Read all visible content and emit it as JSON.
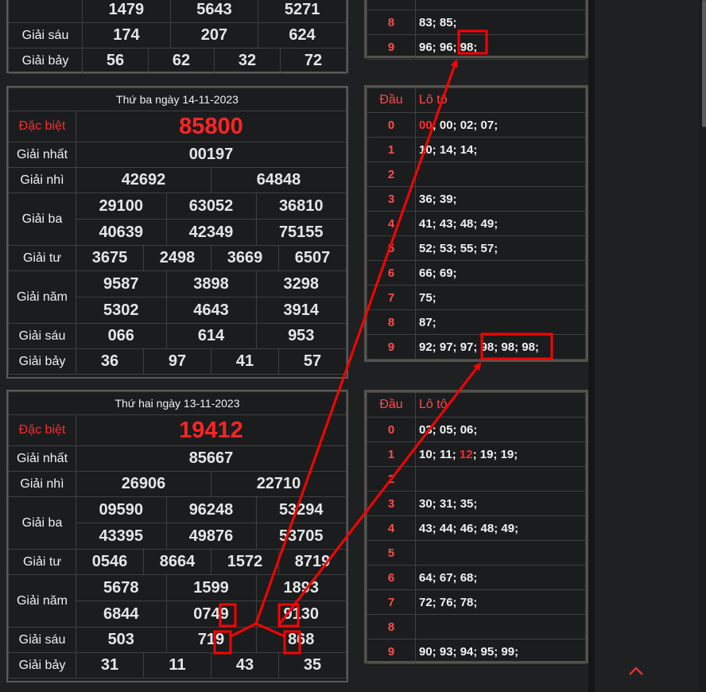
{
  "top_block": {
    "rows": [
      {
        "label": "",
        "values": [
          "1479",
          "5643",
          "5271"
        ]
      },
      {
        "label": "Giải sáu",
        "values": [
          "174",
          "207",
          "624"
        ]
      },
      {
        "label": "Giải bảy",
        "values": [
          "56",
          "62",
          "32",
          "72"
        ]
      }
    ],
    "loto_rows": [
      {
        "d": "8",
        "v": "83; 85;"
      },
      {
        "d": "9",
        "v_pre": "96; 96; ",
        "v_box": "98;"
      }
    ]
  },
  "day1": {
    "title": "Thứ ba ngày 14-11-2023",
    "special_label": "Đặc biệt",
    "special": "85800",
    "first_label": "Giải nhất",
    "first": "00197",
    "second_label": "Giải nhì",
    "second": [
      "42692",
      "64848"
    ],
    "third_label": "Giải ba",
    "third": [
      "29100",
      "63052",
      "36810",
      "40639",
      "42349",
      "75155"
    ],
    "fourth_label": "Giải tư",
    "fourth": [
      "3675",
      "2498",
      "3669",
      "6507"
    ],
    "fifth_label": "Giải năm",
    "fifth": [
      "9587",
      "3898",
      "3298",
      "5302",
      "4643",
      "3914"
    ],
    "sixth_label": "Giải sáu",
    "sixth": [
      "066",
      "614",
      "953"
    ],
    "seventh_label": "Giải bảy",
    "seventh": [
      "36",
      "97",
      "41",
      "57"
    ]
  },
  "loto1": {
    "head_d": "Đầu",
    "head_v": "Lô tô",
    "rows": [
      {
        "d": "0",
        "hl": "00",
        "v": "; 00; 02; 07;"
      },
      {
        "d": "1",
        "v": "10; 14; 14;"
      },
      {
        "d": "2",
        "v": ""
      },
      {
        "d": "3",
        "v": "36; 39;"
      },
      {
        "d": "4",
        "v": "41; 43; 48; 49;"
      },
      {
        "d": "5",
        "v": "52; 53; 55; 57;"
      },
      {
        "d": "6",
        "v": "66; 69;"
      },
      {
        "d": "7",
        "v": "75;"
      },
      {
        "d": "8",
        "v": "87;"
      },
      {
        "d": "9",
        "v_pre": "92; 97; 97; ",
        "v_box": "98; 98; 98;"
      }
    ]
  },
  "day2": {
    "title": "Thứ hai ngày 13-11-2023",
    "special_label": "Đặc biệt",
    "special": "19412",
    "first_label": "Giải nhất",
    "first": "85667",
    "second_label": "Giải nhì",
    "second": [
      "26906",
      "22710"
    ],
    "third_label": "Giải ba",
    "third": [
      "09590",
      "96248",
      "53294",
      "43395",
      "49876",
      "53705"
    ],
    "fourth_label": "Giải tư",
    "fourth": [
      "0546",
      "8664",
      "1572",
      "8719"
    ],
    "fifth_label": "Giải năm",
    "fifth": [
      "5678",
      "1599",
      "1893",
      "6844",
      "0749",
      "9130"
    ],
    "sixth_label": "Giải sáu",
    "sixth": [
      "503",
      "719",
      "868"
    ],
    "seventh_label": "Giải bảy",
    "seventh": [
      "31",
      "11",
      "43",
      "35"
    ]
  },
  "loto2": {
    "head_d": "Đầu",
    "head_v": "Lô tô",
    "rows": [
      {
        "d": "0",
        "v": "03; 05; 06;"
      },
      {
        "d": "1",
        "v_pre": "10; 11; ",
        "hl": "12",
        "v": "; 19; 19;"
      },
      {
        "d": "2",
        "v": ""
      },
      {
        "d": "3",
        "v": "30; 31; 35;"
      },
      {
        "d": "4",
        "v": "43; 44; 46; 48; 49;"
      },
      {
        "d": "5",
        "v": ""
      },
      {
        "d": "6",
        "v": "64; 67; 68;"
      },
      {
        "d": "7",
        "v": "72; 76; 78;"
      },
      {
        "d": "8",
        "v": ""
      },
      {
        "d": "9",
        "v": "90; 93; 94; 95; 99;"
      }
    ]
  },
  "icons": {
    "scroll_top": "chevron-up-icon"
  },
  "colors": {
    "accent_red": "#ff2b2b",
    "annotation_red": "#ff0000"
  }
}
